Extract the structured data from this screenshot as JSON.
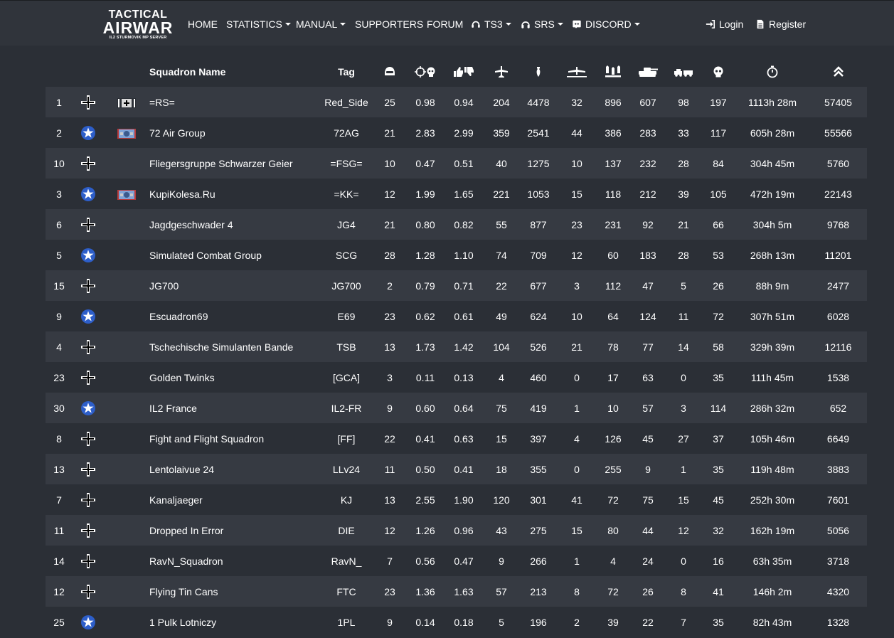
{
  "nav": {
    "logo": {
      "line1": "TACTICAL",
      "line2": "AIRWAR",
      "line3": "IL2 STURMOVIK MP SERVER"
    },
    "items": [
      {
        "label": "HOME",
        "dropdown": false
      },
      {
        "label": "STATISTICS",
        "dropdown": true
      },
      {
        "label": "MANUAL",
        "dropdown": true
      },
      {
        "label": "SUPPORTERS",
        "dropdown": false
      },
      {
        "label": "FORUM",
        "dropdown": false
      },
      {
        "label": "TS3",
        "dropdown": true,
        "icon": "headset-icon"
      },
      {
        "label": "SRS",
        "dropdown": true,
        "icon": "headphones-icon"
      },
      {
        "label": "DISCORD",
        "dropdown": true,
        "icon": "discord-icon"
      }
    ],
    "login": "Login",
    "register": "Register"
  },
  "table": {
    "headers": {
      "name": "Squadron Name",
      "tag": "Tag",
      "icons": [
        "pilot-helmet-icon",
        "crosshair-skull-icon",
        "thumbs-up-down-icon",
        "aircraft-icon",
        "bomb-icon",
        "aircraft-ground-icon",
        "rockets-icon",
        "tank-icon",
        "convoy-icon",
        "skull-icon",
        "stopwatch-icon",
        "chevrons-up-icon"
      ]
    },
    "rows": [
      {
        "rank": "1",
        "side": "axis",
        "flag": "axis-flag",
        "name": "=RS=",
        "tag": "Red_Side",
        "members": "25",
        "kd": "0.98",
        "ratio": "0.94",
        "air": "204",
        "ground": "4478",
        "static_air": "32",
        "static": "896",
        "tanks": "607",
        "vehicles": "98",
        "deaths": "197",
        "time": "1113h 28m",
        "score": "57405"
      },
      {
        "rank": "2",
        "side": "allied",
        "flag": "allied-flag",
        "name": "72 Air Group",
        "tag": "72AG",
        "members": "21",
        "kd": "2.83",
        "ratio": "2.99",
        "air": "359",
        "ground": "2541",
        "static_air": "44",
        "static": "386",
        "tanks": "283",
        "vehicles": "33",
        "deaths": "117",
        "time": "605h 28m",
        "score": "55566"
      },
      {
        "rank": "10",
        "side": "axis",
        "flag": "",
        "name": "Fliegersgruppe Schwarzer Geier",
        "tag": "=FSG=",
        "members": "10",
        "kd": "0.47",
        "ratio": "0.51",
        "air": "40",
        "ground": "1275",
        "static_air": "10",
        "static": "137",
        "tanks": "232",
        "vehicles": "28",
        "deaths": "84",
        "time": "304h 45m",
        "score": "5760"
      },
      {
        "rank": "3",
        "side": "allied",
        "flag": "allied-flag",
        "name": "KupiKolesa.Ru",
        "tag": "=KK=",
        "members": "12",
        "kd": "1.99",
        "ratio": "1.65",
        "air": "221",
        "ground": "1053",
        "static_air": "15",
        "static": "118",
        "tanks": "212",
        "vehicles": "39",
        "deaths": "105",
        "time": "472h 19m",
        "score": "22143"
      },
      {
        "rank": "6",
        "side": "axis",
        "flag": "",
        "name": "Jagdgeschwader 4",
        "tag": "JG4",
        "members": "21",
        "kd": "0.80",
        "ratio": "0.82",
        "air": "55",
        "ground": "877",
        "static_air": "23",
        "static": "231",
        "tanks": "92",
        "vehicles": "21",
        "deaths": "66",
        "time": "304h 5m",
        "score": "9768"
      },
      {
        "rank": "5",
        "side": "allied",
        "flag": "",
        "name": "Simulated Combat Group",
        "tag": "SCG",
        "members": "28",
        "kd": "1.28",
        "ratio": "1.10",
        "air": "74",
        "ground": "709",
        "static_air": "12",
        "static": "60",
        "tanks": "183",
        "vehicles": "28",
        "deaths": "53",
        "time": "268h 13m",
        "score": "11201"
      },
      {
        "rank": "15",
        "side": "axis",
        "flag": "",
        "name": "JG700",
        "tag": "JG700",
        "members": "2",
        "kd": "0.79",
        "ratio": "0.71",
        "air": "22",
        "ground": "677",
        "static_air": "3",
        "static": "112",
        "tanks": "47",
        "vehicles": "5",
        "deaths": "26",
        "time": "88h 9m",
        "score": "2477"
      },
      {
        "rank": "9",
        "side": "allied",
        "flag": "",
        "name": "Escuadron69",
        "tag": "E69",
        "members": "23",
        "kd": "0.62",
        "ratio": "0.61",
        "air": "49",
        "ground": "624",
        "static_air": "10",
        "static": "64",
        "tanks": "124",
        "vehicles": "11",
        "deaths": "72",
        "time": "307h 51m",
        "score": "6028"
      },
      {
        "rank": "4",
        "side": "axis",
        "flag": "",
        "name": "Tschechische Simulanten Bande",
        "tag": "TSB",
        "members": "13",
        "kd": "1.73",
        "ratio": "1.42",
        "air": "104",
        "ground": "526",
        "static_air": "21",
        "static": "78",
        "tanks": "77",
        "vehicles": "14",
        "deaths": "58",
        "time": "329h 39m",
        "score": "12116"
      },
      {
        "rank": "23",
        "side": "axis",
        "flag": "",
        "name": "Golden Twinks",
        "tag": "[GCA]",
        "members": "3",
        "kd": "0.11",
        "ratio": "0.13",
        "air": "4",
        "ground": "460",
        "static_air": "0",
        "static": "17",
        "tanks": "63",
        "vehicles": "0",
        "deaths": "35",
        "time": "111h 45m",
        "score": "1538"
      },
      {
        "rank": "30",
        "side": "allied",
        "flag": "",
        "name": "IL2 France",
        "tag": "IL2-FR",
        "members": "9",
        "kd": "0.60",
        "ratio": "0.64",
        "air": "75",
        "ground": "419",
        "static_air": "1",
        "static": "10",
        "tanks": "57",
        "vehicles": "3",
        "deaths": "114",
        "time": "286h 32m",
        "score": "652"
      },
      {
        "rank": "8",
        "side": "axis",
        "flag": "",
        "name": "Fight and Flight Squadron",
        "tag": "[FF]",
        "members": "22",
        "kd": "0.41",
        "ratio": "0.63",
        "air": "15",
        "ground": "397",
        "static_air": "4",
        "static": "126",
        "tanks": "45",
        "vehicles": "27",
        "deaths": "37",
        "time": "105h 46m",
        "score": "6649"
      },
      {
        "rank": "13",
        "side": "axis",
        "flag": "",
        "name": "Lentolaivue 24",
        "tag": "LLv24",
        "members": "11",
        "kd": "0.50",
        "ratio": "0.41",
        "air": "18",
        "ground": "355",
        "static_air": "0",
        "static": "255",
        "tanks": "9",
        "vehicles": "1",
        "deaths": "35",
        "time": "119h 48m",
        "score": "3883"
      },
      {
        "rank": "7",
        "side": "axis",
        "flag": "",
        "name": "Kanaljaeger",
        "tag": "KJ",
        "members": "13",
        "kd": "2.55",
        "ratio": "1.90",
        "air": "120",
        "ground": "301",
        "static_air": "41",
        "static": "72",
        "tanks": "75",
        "vehicles": "15",
        "deaths": "45",
        "time": "252h 30m",
        "score": "7601"
      },
      {
        "rank": "11",
        "side": "axis",
        "flag": "",
        "name": "Dropped In Error",
        "tag": "DIE",
        "members": "12",
        "kd": "1.26",
        "ratio": "0.96",
        "air": "43",
        "ground": "275",
        "static_air": "15",
        "static": "80",
        "tanks": "44",
        "vehicles": "12",
        "deaths": "32",
        "time": "162h 19m",
        "score": "5056"
      },
      {
        "rank": "14",
        "side": "axis",
        "flag": "",
        "name": "RavN_Squadron",
        "tag": "RavN_",
        "members": "7",
        "kd": "0.56",
        "ratio": "0.47",
        "air": "9",
        "ground": "266",
        "static_air": "1",
        "static": "4",
        "tanks": "24",
        "vehicles": "0",
        "deaths": "16",
        "time": "63h 35m",
        "score": "3718"
      },
      {
        "rank": "12",
        "side": "axis",
        "flag": "",
        "name": "Flying Tin Cans",
        "tag": "FTC",
        "members": "23",
        "kd": "1.36",
        "ratio": "1.63",
        "air": "57",
        "ground": "213",
        "static_air": "8",
        "static": "72",
        "tanks": "26",
        "vehicles": "8",
        "deaths": "41",
        "time": "146h 2m",
        "score": "4320"
      },
      {
        "rank": "25",
        "side": "allied",
        "flag": "",
        "name": "1 Pulk Lotniczy",
        "tag": "1PL",
        "members": "9",
        "kd": "0.14",
        "ratio": "0.18",
        "air": "5",
        "ground": "196",
        "static_air": "2",
        "static": "39",
        "tanks": "22",
        "vehicles": "7",
        "deaths": "35",
        "time": "82h 43m",
        "score": "1328"
      }
    ]
  }
}
